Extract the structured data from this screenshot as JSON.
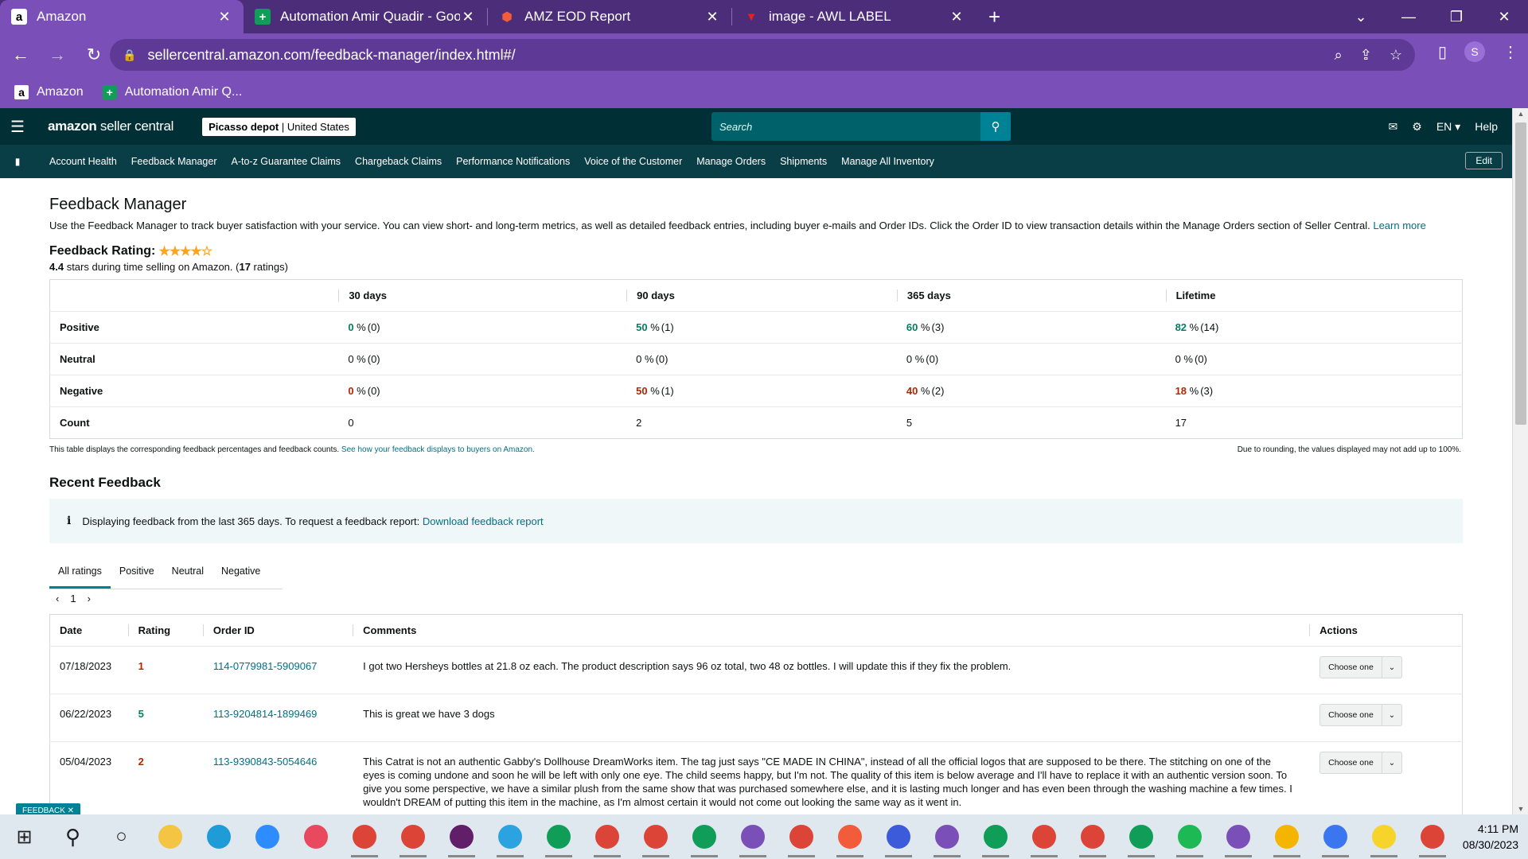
{
  "browser": {
    "tabs": [
      {
        "title": "Amazon",
        "favicon": "a",
        "favicon_bg": "#fff",
        "favicon_fg": "#000",
        "active": true
      },
      {
        "title": "Automation Amir Quadir - Googl",
        "favicon": "+",
        "favicon_bg": "#0f9d58",
        "favicon_fg": "#fff",
        "active": false
      },
      {
        "title": "AMZ EOD Report",
        "favicon": "⬢",
        "favicon_bg": "transparent",
        "favicon_fg": "#f25c3b",
        "active": false
      },
      {
        "title": "image - AWL LABEL",
        "favicon": "▼",
        "favicon_bg": "transparent",
        "favicon_fg": "#e2231a",
        "active": false
      }
    ],
    "url": "sellercentral.amazon.com/feedback-manager/index.html#/",
    "profile_initial": "S",
    "bookmarks": [
      {
        "label": "Amazon",
        "icon": "a",
        "bg": "#fff",
        "fg": "#000"
      },
      {
        "label": "Automation Amir Q...",
        "icon": "+",
        "bg": "#0f9d58",
        "fg": "#fff"
      }
    ]
  },
  "header": {
    "logo_bold": "amazon",
    "logo_light": " seller central",
    "store_name": "Picasso depot",
    "store_region": " | United States",
    "search_placeholder": "Search",
    "lang": "EN ▾",
    "help": "Help"
  },
  "nav": {
    "items": [
      "Account Health",
      "Feedback Manager",
      "A-to-z Guarantee Claims",
      "Chargeback Claims",
      "Performance Notifications",
      "Voice of the Customer",
      "Manage Orders",
      "Shipments",
      "Manage All Inventory"
    ],
    "edit_label": "Edit"
  },
  "page": {
    "title": "Feedback Manager",
    "description": "Use the Feedback Manager to track buyer satisfaction with your service. You can view short- and long-term metrics, as well as detailed feedback entries, including buyer e-mails and Order IDs. Click the Order ID to view transaction details within the Manage Orders section of Seller Central.",
    "learn_more": "Learn more",
    "rating_label": "Feedback Rating:",
    "stars": "★★★★☆",
    "rating_value": "4.4",
    "rating_text_mid": " stars during time selling on Amazon. (",
    "rating_count": "17",
    "rating_text_end": " ratings)"
  },
  "metrics": {
    "columns": [
      "30 days",
      "90 days",
      "365 days",
      "Lifetime"
    ],
    "rows": [
      {
        "label": "Positive",
        "cells": [
          {
            "v": "0",
            "n": "(0)"
          },
          {
            "v": "50",
            "n": "(1)"
          },
          {
            "v": "60",
            "n": "(3)"
          },
          {
            "v": "82",
            "n": "(14)"
          }
        ],
        "tone": "green"
      },
      {
        "label": "Neutral",
        "cells": [
          {
            "v": "0",
            "n": "(0)"
          },
          {
            "v": "0",
            "n": "(0)"
          },
          {
            "v": "0",
            "n": "(0)"
          },
          {
            "v": "0",
            "n": "(0)"
          }
        ],
        "tone": "plain"
      },
      {
        "label": "Negative",
        "cells": [
          {
            "v": "0",
            "n": "(0)"
          },
          {
            "v": "50",
            "n": "(1)"
          },
          {
            "v": "40",
            "n": "(2)"
          },
          {
            "v": "18",
            "n": "(3)"
          }
        ],
        "tone": "red"
      }
    ],
    "count_label": "Count",
    "counts": [
      "0",
      "2",
      "5",
      "17"
    ],
    "footnote_left": "This table displays the corresponding feedback percentages and feedback counts.",
    "footnote_link": "See how your feedback displays to buyers on Amazon.",
    "footnote_right": "Due to rounding, the values displayed may not add up to 100%."
  },
  "recent": {
    "title": "Recent Feedback",
    "info_text": "Displaying feedback from the last 365 days. To request a feedback report:",
    "info_link": "Download feedback report",
    "filter_tabs": [
      "All ratings",
      "Positive",
      "Neutral",
      "Negative"
    ],
    "page": "1",
    "columns": [
      "Date",
      "Rating",
      "Order ID",
      "Comments",
      "Actions"
    ],
    "action_label": "Choose one",
    "rows": [
      {
        "date": "07/18/2023",
        "rating": "1",
        "good": false,
        "order": "114-0779981-5909067",
        "comment": "I got two Hersheys bottles at 21.8 oz each. The product description says 96 oz total, two 48 oz bottles. I will update this if they fix the problem."
      },
      {
        "date": "06/22/2023",
        "rating": "5",
        "good": true,
        "order": "113-9204814-1899469",
        "comment": "This is great we have 3 dogs"
      },
      {
        "date": "05/04/2023",
        "rating": "2",
        "good": false,
        "order": "113-9390843-5054646",
        "comment": "This Catrat is not an authentic Gabby's Dollhouse DreamWorks item. The tag just says \"CE MADE IN CHINA\", instead of all the official logos that are supposed to be there. The stitching on one of the eyes is coming undone and soon he will be left with only one eye. The child seems happy, but I'm not. The quality of this item is below average and I'll have to replace it with an authentic version soon. To give you some perspective, we have a similar plush from the same show that was purchased somewhere else, and it is lasting much longer and has even been through the washing machine a few times. I wouldn't DREAM of putting this item in the machine, as I'm almost certain it would not come out looking the same way as it went in."
      }
    ]
  },
  "feedback_tab": "FEEDBACK ✕",
  "taskbar": {
    "time": "4:11 PM",
    "date": "08/30/2023",
    "icons": [
      {
        "name": "windows-start-icon",
        "c": "#1e1e1e"
      },
      {
        "name": "search-icon",
        "c": "#1e1e1e"
      },
      {
        "name": "task-view-icon",
        "c": "#1e1e1e"
      },
      {
        "name": "file-explorer-icon",
        "c": "#f4c542"
      },
      {
        "name": "edge-icon",
        "c": "#1f9bd8"
      },
      {
        "name": "zoom-icon",
        "c": "#2d8cff"
      },
      {
        "name": "snipping-tool-icon",
        "c": "#e8495f"
      },
      {
        "name": "chrome-icon",
        "c": "#db4437"
      },
      {
        "name": "chrome-icon",
        "c": "#db4437"
      },
      {
        "name": "slack-icon",
        "c": "#611f69"
      },
      {
        "name": "telegram-icon",
        "c": "#2aa3e0"
      },
      {
        "name": "chrome-icon",
        "c": "#0f9d58"
      },
      {
        "name": "chrome-icon",
        "c": "#db4437"
      },
      {
        "name": "chrome-icon",
        "c": "#db4437"
      },
      {
        "name": "chrome-icon",
        "c": "#0f9d58"
      },
      {
        "name": "chrome-icon",
        "c": "#7b4fb8"
      },
      {
        "name": "chrome-icon",
        "c": "#db4437"
      },
      {
        "name": "chrome-icon",
        "c": "#f25c3b"
      },
      {
        "name": "chrome-icon",
        "c": "#3b5bdb"
      },
      {
        "name": "chrome-icon",
        "c": "#7b4fb8"
      },
      {
        "name": "chrome-icon",
        "c": "#0f9d58"
      },
      {
        "name": "chrome-icon",
        "c": "#db4437"
      },
      {
        "name": "chrome-icon",
        "c": "#db4437"
      },
      {
        "name": "chrome-icon",
        "c": "#0f9d58"
      },
      {
        "name": "spotify-icon",
        "c": "#1db954"
      },
      {
        "name": "chrome-icon",
        "c": "#7b4fb8"
      },
      {
        "name": "chrome-icon",
        "c": "#f4b400"
      },
      {
        "name": "signal-icon",
        "c": "#3a76f0"
      },
      {
        "name": "sticky-notes-icon",
        "c": "#f7d42c"
      },
      {
        "name": "chrome-icon",
        "c": "#db4437"
      }
    ]
  }
}
